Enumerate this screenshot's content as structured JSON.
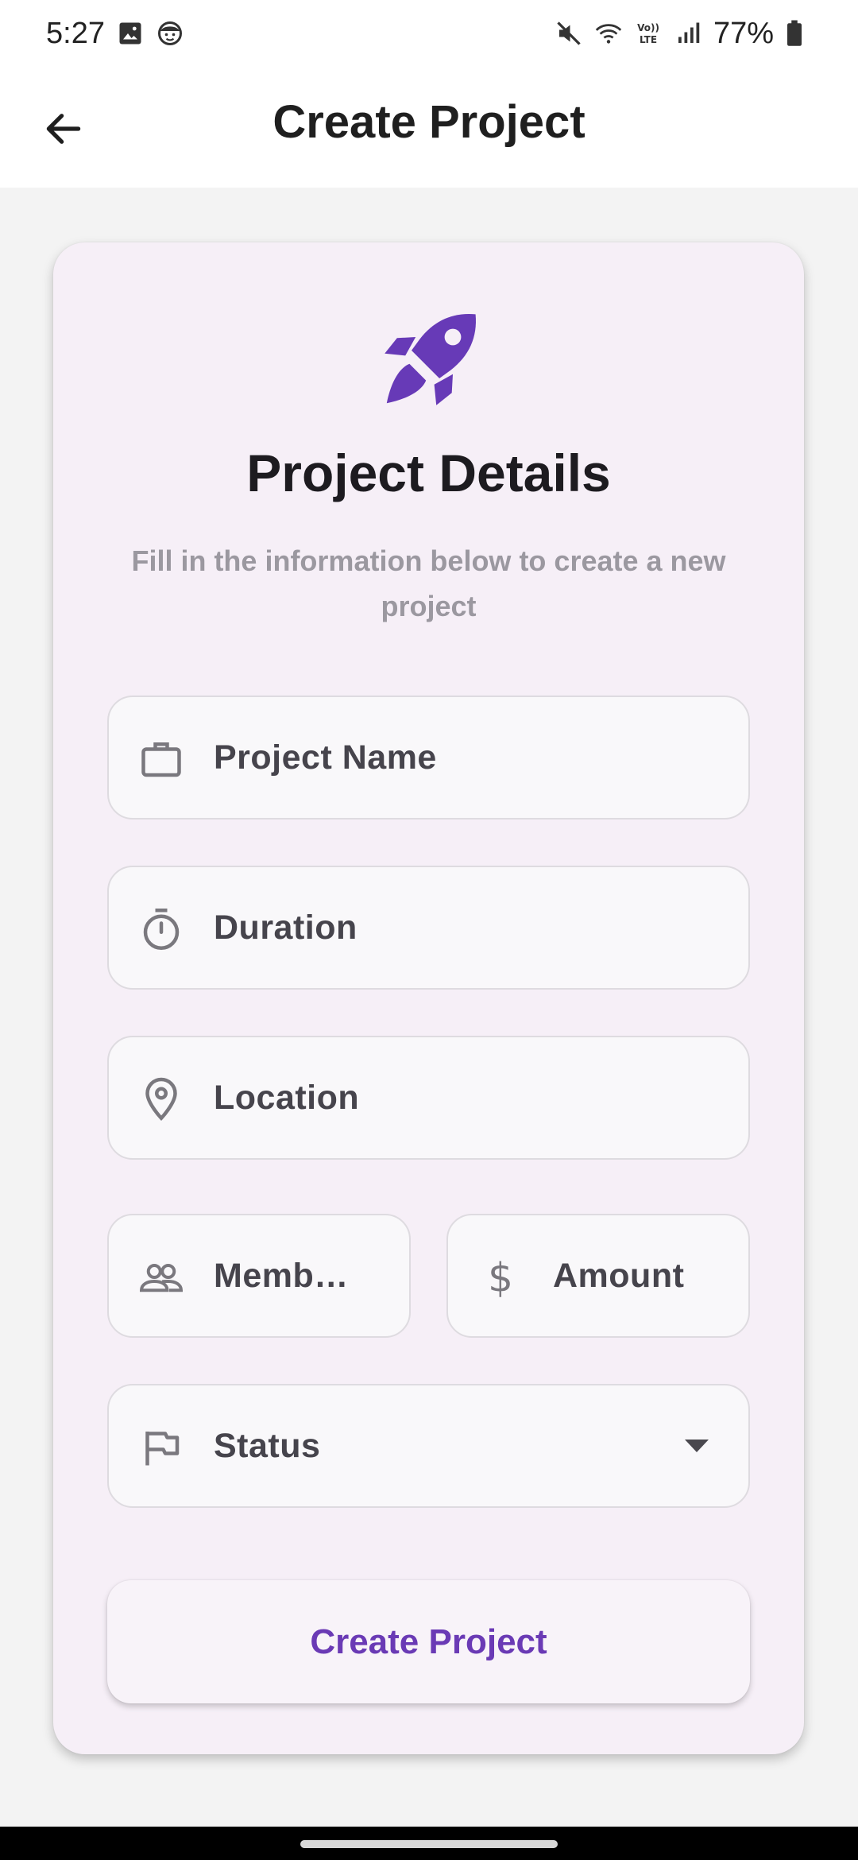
{
  "status_bar": {
    "time": "5:27",
    "battery": "77%",
    "left_icons": [
      "gallery-icon",
      "face-icon"
    ],
    "right_icons": [
      "mute-icon",
      "wifi-icon",
      "volte-icon",
      "signal-icon",
      "battery-icon"
    ]
  },
  "app_bar": {
    "title": "Create Project",
    "back_icon": "arrow-back-icon"
  },
  "card": {
    "icon": "rocket-icon",
    "title": "Project Details",
    "subtitle": "Fill in the information below to create a new project",
    "fields": {
      "project_name": {
        "label": "Project Name",
        "icon": "briefcase-icon"
      },
      "duration": {
        "label": "Duration",
        "icon": "timer-icon"
      },
      "location": {
        "label": "Location",
        "icon": "location-pin-icon"
      },
      "members": {
        "label": "Memb…",
        "icon": "people-icon"
      },
      "amount": {
        "label": "Amount",
        "icon": "dollar-icon"
      },
      "status": {
        "label": "Status",
        "icon": "flag-icon"
      }
    },
    "submit_label": "Create Project"
  },
  "colors": {
    "accent": "#673ab7",
    "card_background": "#f6eff7",
    "page_background": "#f3f3f3"
  }
}
